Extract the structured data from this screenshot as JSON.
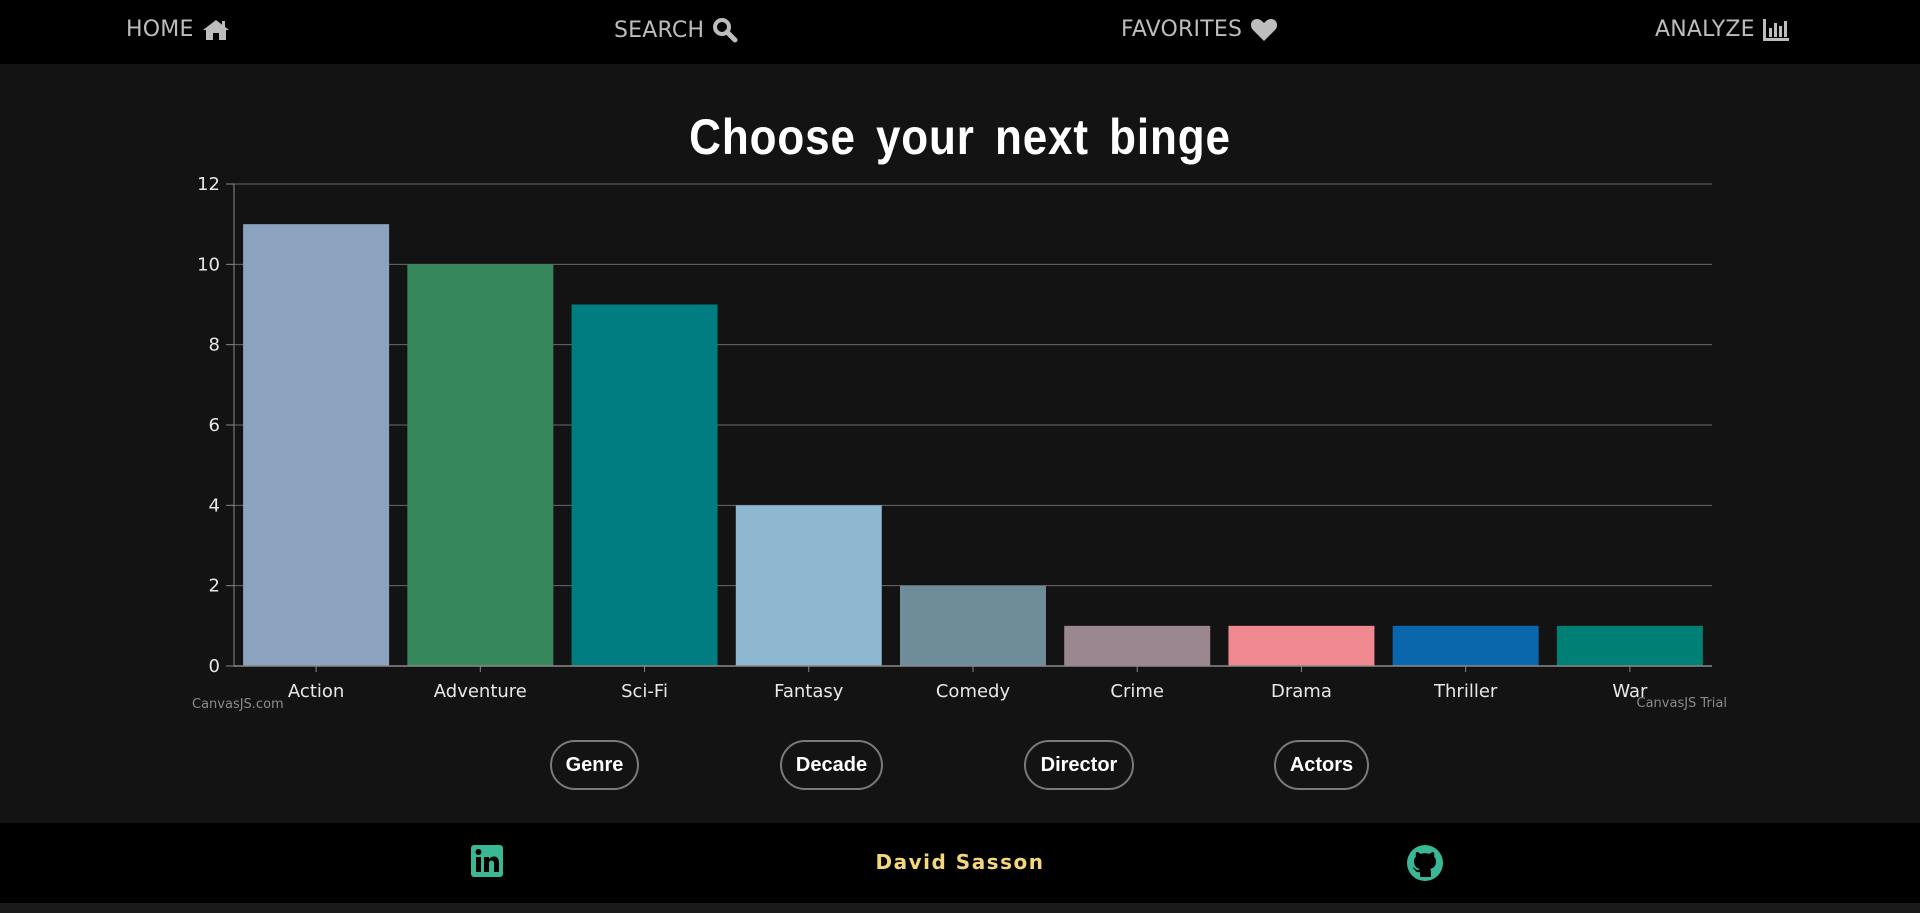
{
  "nav": {
    "home_label": "HOME",
    "search_label": "SEARCH",
    "favorites_label": "FAVORITES",
    "analyze_label": "ANALYZE",
    "icons": {
      "home": "home-icon",
      "search": "search-icon",
      "favorites": "heart-icon",
      "analyze": "bar-chart-icon"
    }
  },
  "page": {
    "title": "Choose your next binge"
  },
  "chart_data": {
    "type": "bar",
    "title": "",
    "xlabel": "",
    "ylabel": "",
    "categories": [
      "Action",
      "Adventure",
      "Sci-Fi",
      "Fantasy",
      "Comedy",
      "Crime",
      "Drama",
      "Thriller",
      "War"
    ],
    "values": [
      11,
      10,
      9,
      4,
      2,
      1,
      1,
      1,
      1
    ],
    "colors": [
      "#8ba3bf",
      "#37875d",
      "#007d81",
      "#8db8cf",
      "#6f8d98",
      "#9a8790",
      "#f0888f",
      "#0a67ab",
      "#007f74"
    ],
    "ylim": [
      0,
      12
    ],
    "yticks": [
      0,
      2,
      4,
      6,
      8,
      10,
      12
    ],
    "grid": true,
    "credit_left": "CanvasJS.com",
    "credit_right": "CanvasJS Trial"
  },
  "filters": {
    "genre_label": "Genre",
    "decade_label": "Decade",
    "director_label": "Director",
    "actors_label": "Actors"
  },
  "footer": {
    "author": "David Sasson",
    "accent_color": "#3ab795",
    "icons": {
      "left": "linkedin-icon",
      "right": "github-icon"
    }
  },
  "theme": {
    "background": "#131313",
    "bar_background": "#000000",
    "nav_text": "#bdbdbd"
  }
}
